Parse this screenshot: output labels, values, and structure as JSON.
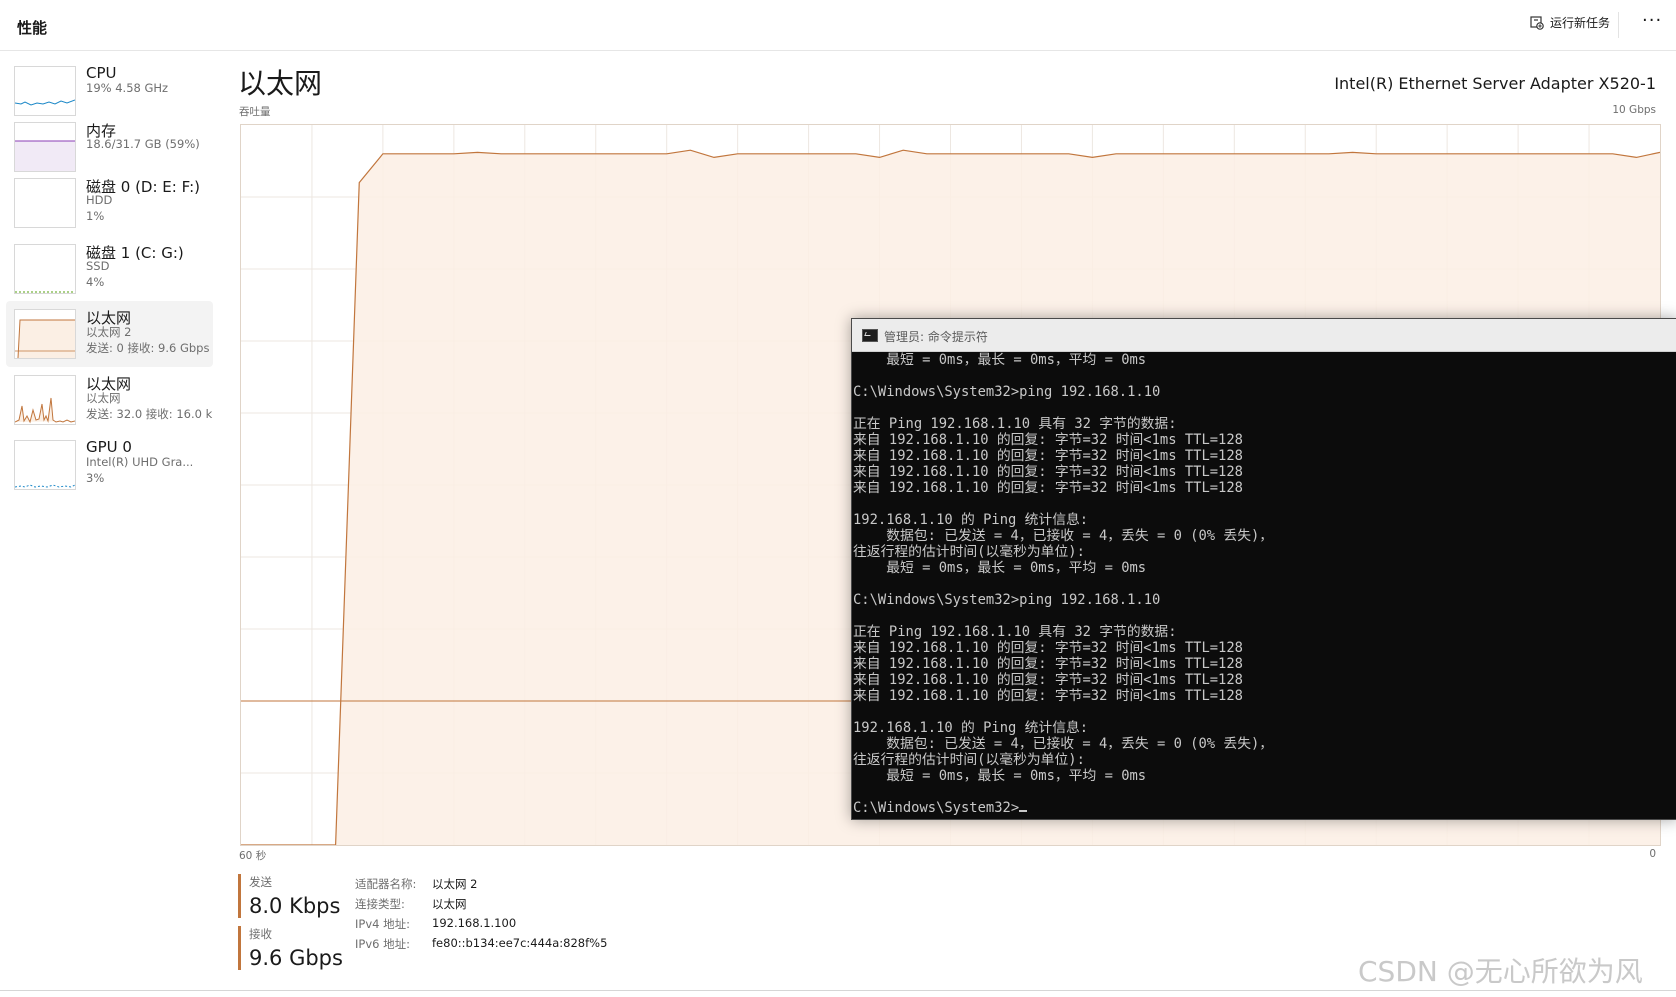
{
  "header": {
    "title": "性能",
    "run_task_label": "运行新任务",
    "more_label": "···"
  },
  "sidebar": {
    "items": [
      {
        "name": "CPU",
        "line1": "19% 4.58 GHz",
        "line2": "",
        "color": "#1a87c7"
      },
      {
        "name": "内存",
        "line1": "18.6/31.7 GB (59%)",
        "line2": "",
        "color": "#8b3fb5"
      },
      {
        "name": "磁盘 0 (D: E: F:)",
        "line1": "HDD",
        "line2": "1%",
        "color": "#56a20f"
      },
      {
        "name": "磁盘 1 (C: G:)",
        "line1": "SSD",
        "line2": "4%",
        "color": "#56a20f"
      },
      {
        "name": "以太网",
        "line1": "以太网 2",
        "line2": "发送: 0 接收: 9.6 Gbps",
        "color": "#c1763d",
        "selected": true
      },
      {
        "name": "以太网",
        "line1": "以太网",
        "line2": "发送: 32.0 接收: 16.0 k",
        "color": "#c1763d"
      },
      {
        "name": "GPU 0",
        "line1": "Intel(R) UHD Gra...",
        "line2": "3%",
        "color": "#1a87c7"
      }
    ]
  },
  "main": {
    "title": "以太网",
    "adapter_name": "Intel(R) Ethernet Server Adapter X520-1",
    "throughput_label": "吞吐量",
    "max_label": "10 Gbps",
    "x_left_label": "60 秒",
    "x_right_label": "0"
  },
  "chart_data": {
    "type": "area",
    "y_unit": "Gbps",
    "ylim": [
      0,
      10
    ],
    "x_seconds_ago": [
      60,
      59,
      58,
      57,
      56,
      55,
      54,
      53,
      52,
      51,
      50,
      49,
      48,
      47,
      46,
      45,
      44,
      43,
      42,
      41,
      40,
      39,
      38,
      37,
      36,
      35,
      34,
      33,
      32,
      31,
      30,
      29,
      28,
      27,
      26,
      25,
      24,
      23,
      22,
      21,
      20,
      19,
      18,
      17,
      16,
      15,
      14,
      13,
      12,
      11,
      10,
      9,
      8,
      7,
      6,
      5,
      4,
      3,
      2,
      1,
      0
    ],
    "series": [
      {
        "values": [
          0,
          0,
          0,
          0,
          0,
          9.2,
          9.6,
          9.6,
          9.6,
          9.6,
          9.62,
          9.6,
          9.6,
          9.6,
          9.6,
          9.6,
          9.6,
          9.6,
          9.6,
          9.65,
          9.55,
          9.6,
          9.6,
          9.6,
          9.6,
          9.6,
          9.6,
          9.55,
          9.65,
          9.6,
          9.6,
          9.6,
          9.6,
          9.6,
          9.6,
          9.6,
          9.55,
          9.6,
          9.6,
          9.6,
          9.6,
          9.6,
          9.6,
          9.6,
          9.6,
          9.6,
          9.6,
          9.62,
          9.6,
          9.6,
          9.6,
          9.6,
          9.6,
          9.6,
          9.6,
          9.6,
          9.6,
          9.6,
          9.6,
          9.55,
          9.62
        ],
        "color": "#c1763d"
      },
      {
        "values": [
          2,
          2,
          2,
          2,
          2,
          2,
          2,
          2,
          2,
          2,
          2,
          2,
          2,
          2,
          2,
          2,
          2,
          2,
          2,
          2,
          2,
          2,
          2,
          2,
          2,
          2,
          2,
          2,
          2,
          2,
          2,
          2,
          2,
          2,
          2,
          2,
          2,
          2,
          2,
          2,
          2,
          2,
          2,
          2,
          2,
          2,
          2,
          2,
          2,
          2,
          2,
          2,
          2,
          2,
          2,
          2,
          2,
          2,
          2,
          2,
          2
        ],
        "color": "#c1763d",
        "dashed": false
      }
    ],
    "grid": true
  },
  "stats": {
    "send_label": "发送",
    "send_value": "8.0 Kbps",
    "recv_label": "接收",
    "recv_value": "9.6 Gbps"
  },
  "info": [
    {
      "k": "适配器名称:",
      "v": "以太网 2"
    },
    {
      "k": "连接类型:",
      "v": "以太网"
    },
    {
      "k": "IPv4 地址:",
      "v": "192.168.1.100"
    },
    {
      "k": "IPv6 地址:",
      "v": "fe80::b134:ee7c:444a:828f%5"
    }
  ],
  "cmd": {
    "title": "管理员: 命令提示符",
    "lines": [
      "    最短 = 0ms，最长 = 0ms，平均 = 0ms",
      "",
      "C:\\Windows\\System32>ping 192.168.1.10",
      "",
      "正在 Ping 192.168.1.10 具有 32 字节的数据:",
      "来自 192.168.1.10 的回复: 字节=32 时间<1ms TTL=128",
      "来自 192.168.1.10 的回复: 字节=32 时间<1ms TTL=128",
      "来自 192.168.1.10 的回复: 字节=32 时间<1ms TTL=128",
      "来自 192.168.1.10 的回复: 字节=32 时间<1ms TTL=128",
      "",
      "192.168.1.10 的 Ping 统计信息:",
      "    数据包: 已发送 = 4，已接收 = 4，丢失 = 0 (0% 丢失)，",
      "往返行程的估计时间(以毫秒为单位):",
      "    最短 = 0ms，最长 = 0ms，平均 = 0ms",
      "",
      "C:\\Windows\\System32>ping 192.168.1.10",
      "",
      "正在 Ping 192.168.1.10 具有 32 字节的数据:",
      "来自 192.168.1.10 的回复: 字节=32 时间<1ms TTL=128",
      "来自 192.168.1.10 的回复: 字节=32 时间<1ms TTL=128",
      "来自 192.168.1.10 的回复: 字节=32 时间<1ms TTL=128",
      "来自 192.168.1.10 的回复: 字节=32 时间<1ms TTL=128",
      "",
      "192.168.1.10 的 Ping 统计信息:",
      "    数据包: 已发送 = 4，已接收 = 4，丢失 = 0 (0% 丢失)，",
      "往返行程的估计时间(以毫秒为单位):",
      "    最短 = 0ms，最长 = 0ms，平均 = 0ms",
      "",
      "C:\\Windows\\System32>"
    ]
  },
  "watermark": "CSDN @无心所欲为风"
}
